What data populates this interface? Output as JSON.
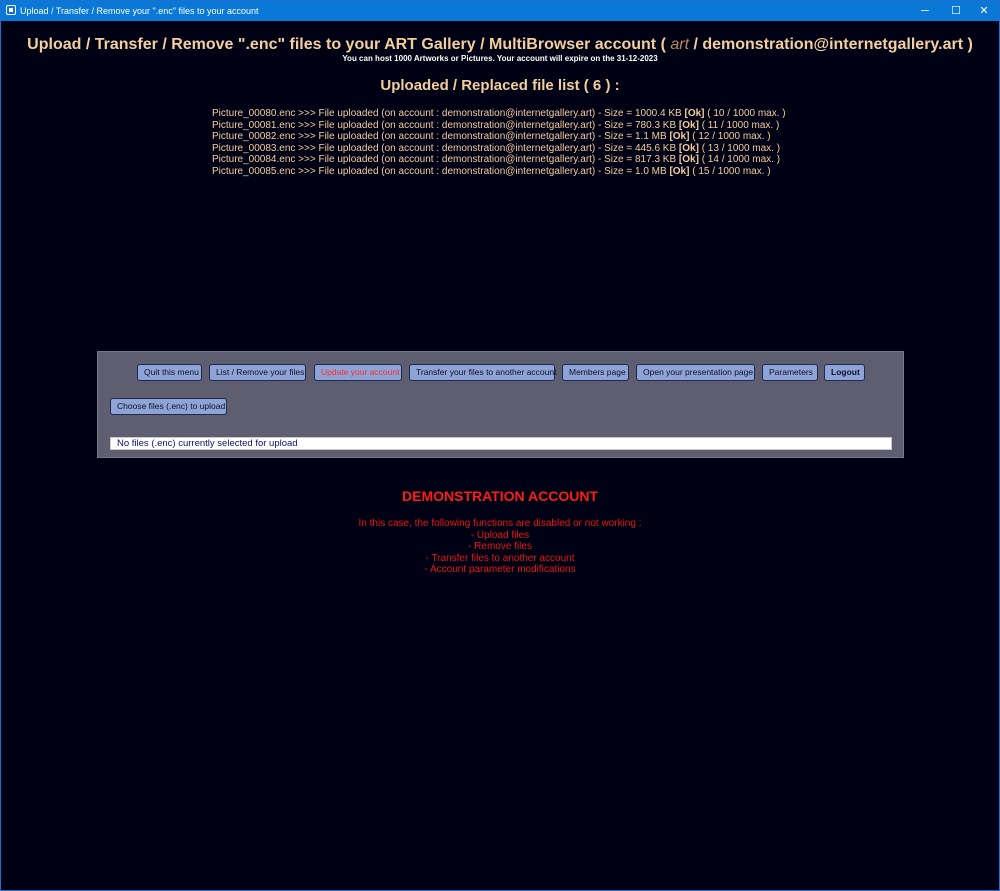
{
  "window": {
    "title": "Upload / Transfer / Remove your \".enc\" files to your account",
    "minimize_glyph": "─",
    "maximize_glyph": "☐",
    "close_glyph": "✕"
  },
  "header": {
    "title_prefix": "Upload / Transfer / Remove \".enc\" files to your ART Gallery / MultiBrowser account ( ",
    "account_name": "art",
    "title_suffix": " / demonstration@internetgallery.art )",
    "subtitle": "You can host 1000 Artworks or Pictures. Your account will expire on the 31-12-2023"
  },
  "file_list": {
    "title": "Uploaded / Replaced file list ( 6 ) :",
    "items": [
      {
        "pre": "Picture_00080.enc >>> File uploaded (on account : demonstration@internetgallery.art) - Size = 1000.4 KB ",
        "status": "[Ok]",
        "post": " ( 10 / 1000 max. )"
      },
      {
        "pre": "Picture_00081.enc >>> File uploaded (on account : demonstration@internetgallery.art) - Size = 780.3 KB ",
        "status": "[Ok]",
        "post": " ( 11 / 1000 max. )"
      },
      {
        "pre": "Picture_00082.enc >>> File uploaded (on account : demonstration@internetgallery.art) - Size = 1.1 MB ",
        "status": "[Ok]",
        "post": " ( 12 / 1000 max. )"
      },
      {
        "pre": "Picture_00083.enc >>> File uploaded (on account : demonstration@internetgallery.art) - Size = 445.6 KB ",
        "status": "[Ok]",
        "post": " ( 13 / 1000 max. )"
      },
      {
        "pre": "Picture_00084.enc >>> File uploaded (on account : demonstration@internetgallery.art) - Size = 817.3 KB ",
        "status": "[Ok]",
        "post": " ( 14 / 1000 max. )"
      },
      {
        "pre": "Picture_00085.enc >>> File uploaded (on account : demonstration@internetgallery.art) - Size = 1.0 MB ",
        "status": "[Ok]",
        "post": " ( 15 / 1000 max. )"
      }
    ]
  },
  "toolbar": {
    "quit": "Quit this menu",
    "list_remove": "List / Remove your files",
    "update_account": "Update your account",
    "transfer": "Transfer your files to another account",
    "members": "Members page",
    "presentation": "Open your presentation page",
    "parameters": "Parameters",
    "logout": "Logout",
    "choose_files": "Choose files (.enc) to upload",
    "status": "No files (.enc) currently selected for upload",
    "active_color": "#ff2a2a"
  },
  "demo": {
    "title": "DEMONSTRATION ACCOUNT",
    "lines": [
      "In this case, the following functions are disabled or not working :",
      "- Upload files",
      "- Remove files",
      "- Transfer files to another account",
      "- Account parameter modifications"
    ]
  },
  "colors": {
    "background": "#000014",
    "titlebar": "#0a78d7",
    "accent_text": "#f3cf9e",
    "warning_red": "#ff1a1a",
    "button_bg": "#8ea3d6",
    "panel_bg": "#5f5e71"
  }
}
